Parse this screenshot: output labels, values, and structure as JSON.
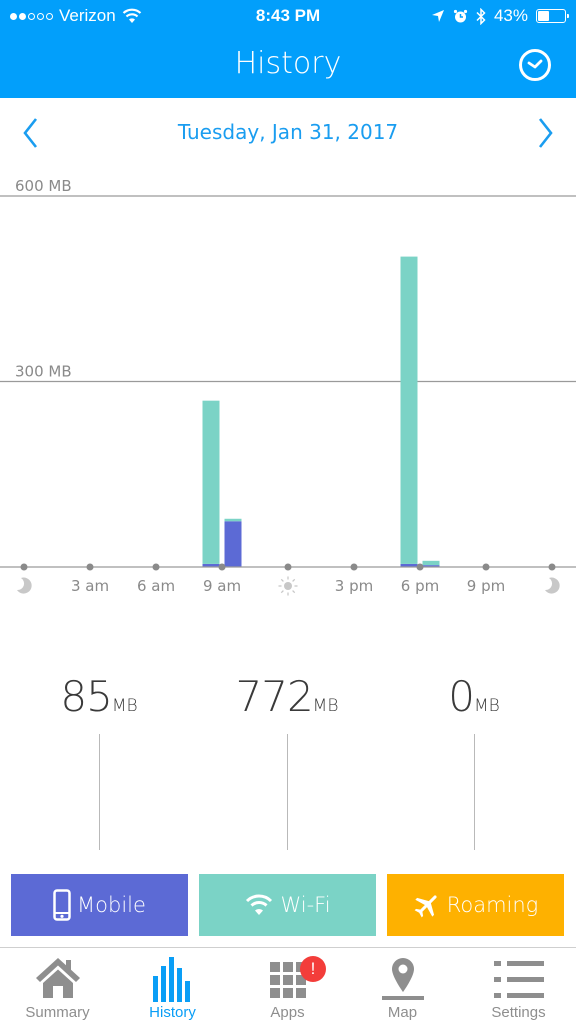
{
  "status_bar": {
    "carrier": "Verizon",
    "signal_bars_filled": 2,
    "signal_bars_total": 5,
    "time": "8:43 PM",
    "battery": "43%",
    "battery_level": 0.43
  },
  "header": {
    "title": "History",
    "clock_icon": "clock-icon"
  },
  "date_nav": {
    "date": "Tuesday, Jan 31, 2017",
    "prev_icon": "chevron-left-icon",
    "next_icon": "chevron-right-icon"
  },
  "colors": {
    "brand": "#029ffb",
    "mobile": "#5c6ad5",
    "wifi": "#7bd3c6",
    "roaming": "#feb100",
    "badge": "#f33d3a"
  },
  "chart_data": {
    "type": "bar",
    "stacked": true,
    "ylabel": "MB",
    "ylim": [
      0,
      600
    ],
    "y_ticks": [
      {
        "value": 300,
        "label": "300 MB"
      },
      {
        "value": 600,
        "label": "600 MB"
      }
    ],
    "x_range_hours": [
      0,
      24
    ],
    "x_ticks": [
      {
        "hour": 0,
        "label": "",
        "icon": "moon-icon"
      },
      {
        "hour": 3,
        "label": "3 am"
      },
      {
        "hour": 6,
        "label": "6 am"
      },
      {
        "hour": 9,
        "label": "9 am"
      },
      {
        "hour": 12,
        "label": "",
        "icon": "sun-icon"
      },
      {
        "hour": 15,
        "label": "3 pm"
      },
      {
        "hour": 18,
        "label": "6 pm"
      },
      {
        "hour": 21,
        "label": "9 pm"
      },
      {
        "hour": 24,
        "label": "",
        "icon": "moon-icon"
      }
    ],
    "bars": [
      {
        "hour": 8,
        "mobile": 5,
        "wifi": 264,
        "roaming": 0
      },
      {
        "hour": 9,
        "mobile": 74,
        "wifi": 4,
        "roaming": 0
      },
      {
        "hour": 17,
        "mobile": 5,
        "wifi": 497,
        "roaming": 0
      },
      {
        "hour": 18,
        "mobile": 3,
        "wifi": 7,
        "roaming": 0
      }
    ],
    "grid": true,
    "legend": "bottom"
  },
  "totals": [
    {
      "key": "mobile",
      "value": "85",
      "unit": "MB"
    },
    {
      "key": "wifi",
      "value": "772",
      "unit": "MB"
    },
    {
      "key": "roaming",
      "value": "0",
      "unit": "MB"
    }
  ],
  "legend": [
    {
      "key": "mobile",
      "label": "Mobile",
      "icon": "phone-icon"
    },
    {
      "key": "wifi",
      "label": "Wi-Fi",
      "icon": "wifi-icon"
    },
    {
      "key": "roaming",
      "label": "Roaming",
      "icon": "airplane-icon"
    }
  ],
  "tabs": [
    {
      "label": "Summary",
      "icon": "home-icon",
      "active": false
    },
    {
      "label": "History",
      "icon": "bar-chart-icon",
      "active": true
    },
    {
      "label": "Apps",
      "icon": "grid-icon",
      "active": false,
      "badge": "!"
    },
    {
      "label": "Map",
      "icon": "map-pin-icon",
      "active": false
    },
    {
      "label": "Settings",
      "icon": "list-icon",
      "active": false
    }
  ]
}
